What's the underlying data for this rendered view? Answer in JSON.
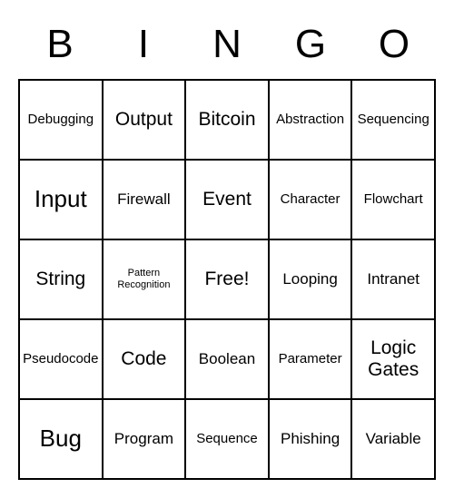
{
  "header": [
    "B",
    "I",
    "N",
    "G",
    "O"
  ],
  "grid": [
    [
      {
        "text": "Debugging",
        "size": ""
      },
      {
        "text": "Output",
        "size": "large"
      },
      {
        "text": "Bitcoin",
        "size": "large"
      },
      {
        "text": "Abstraction",
        "size": ""
      },
      {
        "text": "Sequencing",
        "size": ""
      }
    ],
    [
      {
        "text": "Input",
        "size": "xlarge"
      },
      {
        "text": "Firewall",
        "size": "med"
      },
      {
        "text": "Event",
        "size": "large"
      },
      {
        "text": "Character",
        "size": ""
      },
      {
        "text": "Flowchart",
        "size": ""
      }
    ],
    [
      {
        "text": "String",
        "size": "large"
      },
      {
        "text": "Pattern Recognition",
        "size": "small"
      },
      {
        "text": "Free!",
        "size": "large"
      },
      {
        "text": "Looping",
        "size": "med"
      },
      {
        "text": "Intranet",
        "size": "med"
      }
    ],
    [
      {
        "text": "Pseudocode",
        "size": ""
      },
      {
        "text": "Code",
        "size": "large"
      },
      {
        "text": "Boolean",
        "size": "med"
      },
      {
        "text": "Parameter",
        "size": ""
      },
      {
        "text": "Logic Gates",
        "size": "large"
      }
    ],
    [
      {
        "text": "Bug",
        "size": "xlarge"
      },
      {
        "text": "Program",
        "size": "med"
      },
      {
        "text": "Sequence",
        "size": ""
      },
      {
        "text": "Phishing",
        "size": "med"
      },
      {
        "text": "Variable",
        "size": "med"
      }
    ]
  ]
}
